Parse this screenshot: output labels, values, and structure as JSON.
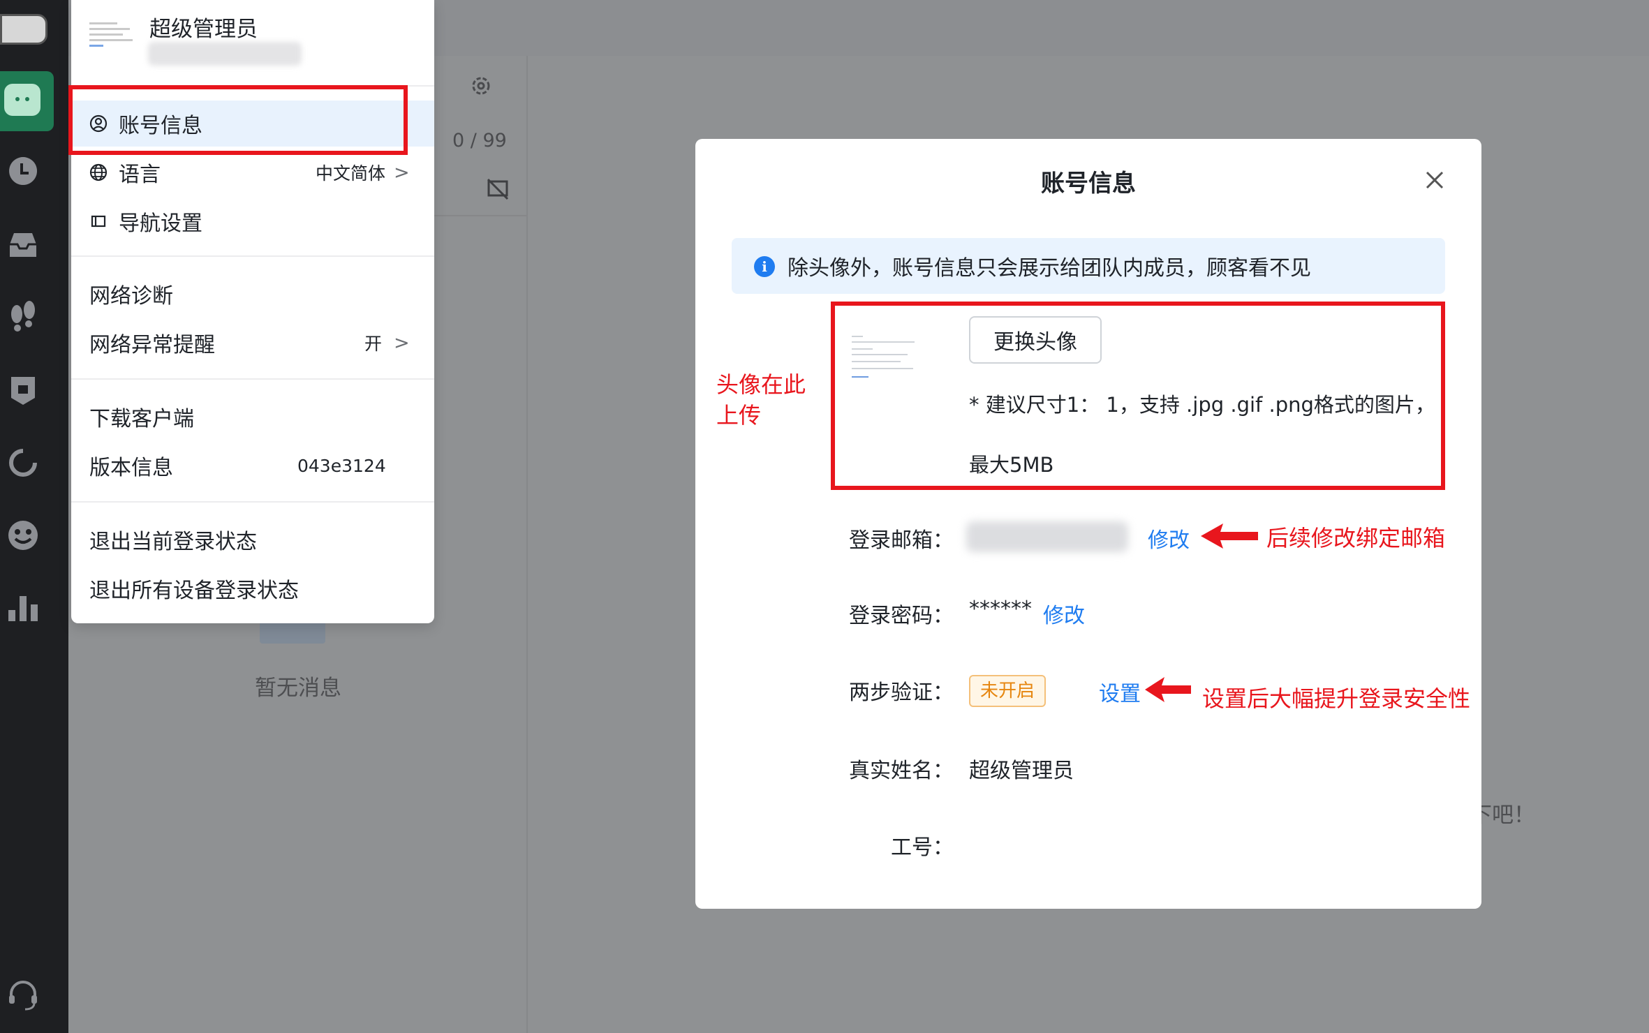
{
  "menu": {
    "user_name": "超级管理员",
    "items": [
      {
        "label": "账号信息"
      },
      {
        "label": "语言",
        "value": "中文简体"
      },
      {
        "label": "导航设置"
      },
      {
        "label": "网络诊断"
      },
      {
        "label": "网络异常提醒",
        "value": "开"
      },
      {
        "label": "下载客户端"
      },
      {
        "label": "版本信息",
        "value": "043e3124"
      },
      {
        "label": "退出当前登录状态"
      },
      {
        "label": "退出所有设备登录状态"
      }
    ]
  },
  "background": {
    "count": "0 / 99",
    "empty_text": "暂无消息",
    "partial_text": "下吧！"
  },
  "modal": {
    "title": "账号信息",
    "notice": "除头像外，账号信息只会展示给团队内成员，顾客看不见",
    "change_avatar": "更换头像",
    "avatar_hint_line1": "* 建议尺寸1： 1，支持 .jpg .gif .png格式的图片，",
    "avatar_hint_line2": "最大5MB",
    "email_label": "登录邮箱：",
    "email_edit": "修改",
    "password_label": "登录密码：",
    "password_value": "******",
    "password_edit": "修改",
    "two_step_label": "两步验证：",
    "two_step_status": "未开启",
    "two_step_action": "设置",
    "real_name_label": "真实姓名：",
    "real_name_value": "超级管理员",
    "employee_id_label": "工号："
  },
  "annotations": {
    "avatar_upload": [
      "头像在此",
      "上传"
    ],
    "email": "后续修改绑定邮箱",
    "two_step": "设置后大幅提升登录安全性"
  },
  "colors": {
    "annotation_red": "#e8161d",
    "link_blue": "#1f7cf0",
    "rail_bg": "#1e1f22",
    "rail_active": "#1f7a53",
    "badge_orange": "#e6860f"
  },
  "icons": [
    "chat-icon",
    "history-icon",
    "inbox-icon",
    "footprint-icon",
    "ticket-icon",
    "loading-icon",
    "emoji-icon",
    "stats-icon",
    "headset-icon",
    "gear-icon",
    "close-icon",
    "info-icon",
    "user-circle-icon",
    "globe-icon",
    "panel-icon",
    "chevron-right-icon"
  ]
}
